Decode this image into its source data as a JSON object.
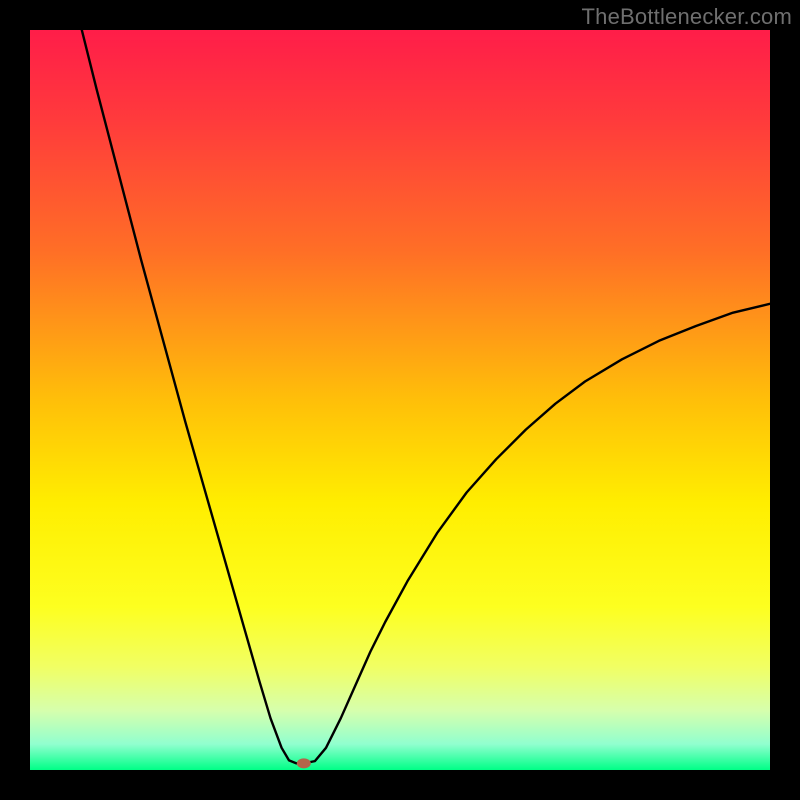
{
  "watermark": "TheBottlenecker.com",
  "chart_data": {
    "type": "line",
    "title": "",
    "xlabel": "",
    "ylabel": "",
    "xlim": [
      0,
      100
    ],
    "ylim": [
      0,
      100
    ],
    "gradient_stops": [
      {
        "offset": 0.0,
        "color": "#ff1d49"
      },
      {
        "offset": 0.12,
        "color": "#ff3a3c"
      },
      {
        "offset": 0.3,
        "color": "#ff6f26"
      },
      {
        "offset": 0.5,
        "color": "#ffbf09"
      },
      {
        "offset": 0.64,
        "color": "#ffee00"
      },
      {
        "offset": 0.78,
        "color": "#fdff20"
      },
      {
        "offset": 0.86,
        "color": "#f1ff63"
      },
      {
        "offset": 0.92,
        "color": "#d6ffad"
      },
      {
        "offset": 0.965,
        "color": "#91ffcf"
      },
      {
        "offset": 1.0,
        "color": "#00ff87"
      }
    ],
    "curve": [
      {
        "x": 7.0,
        "y": 100.0
      },
      {
        "x": 9.0,
        "y": 92.0
      },
      {
        "x": 12.0,
        "y": 80.5
      },
      {
        "x": 15.0,
        "y": 69.0
      },
      {
        "x": 18.0,
        "y": 58.0
      },
      {
        "x": 21.0,
        "y": 47.0
      },
      {
        "x": 24.0,
        "y": 36.5
      },
      {
        "x": 27.0,
        "y": 26.0
      },
      {
        "x": 29.0,
        "y": 19.0
      },
      {
        "x": 31.0,
        "y": 12.0
      },
      {
        "x": 32.5,
        "y": 7.0
      },
      {
        "x": 34.0,
        "y": 3.0
      },
      {
        "x": 35.0,
        "y": 1.3
      },
      {
        "x": 36.0,
        "y": 0.9
      },
      {
        "x": 37.0,
        "y": 0.9
      },
      {
        "x": 38.5,
        "y": 1.2
      },
      {
        "x": 40.0,
        "y": 3.0
      },
      {
        "x": 42.0,
        "y": 7.0
      },
      {
        "x": 44.0,
        "y": 11.5
      },
      {
        "x": 46.0,
        "y": 16.0
      },
      {
        "x": 48.0,
        "y": 20.0
      },
      {
        "x": 51.0,
        "y": 25.5
      },
      {
        "x": 55.0,
        "y": 32.0
      },
      {
        "x": 59.0,
        "y": 37.5
      },
      {
        "x": 63.0,
        "y": 42.0
      },
      {
        "x": 67.0,
        "y": 46.0
      },
      {
        "x": 71.0,
        "y": 49.5
      },
      {
        "x": 75.0,
        "y": 52.5
      },
      {
        "x": 80.0,
        "y": 55.5
      },
      {
        "x": 85.0,
        "y": 58.0
      },
      {
        "x": 90.0,
        "y": 60.0
      },
      {
        "x": 95.0,
        "y": 61.8
      },
      {
        "x": 100.0,
        "y": 63.0
      }
    ],
    "marker": {
      "x": 37.0,
      "y": 0.9,
      "rx": 7,
      "ry": 5,
      "color": "#b4644a"
    }
  }
}
